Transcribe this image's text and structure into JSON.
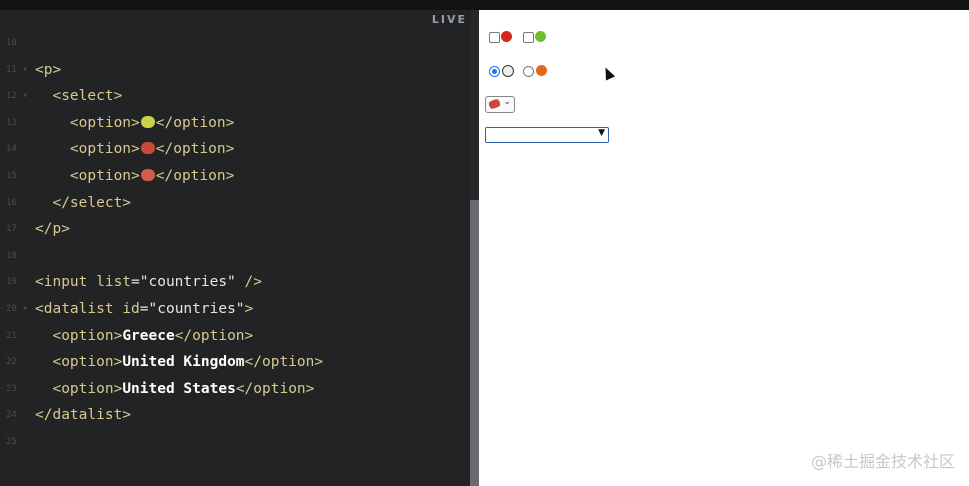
{
  "editor": {
    "live_label": "LIVE",
    "lines": [
      {
        "num": "10",
        "fold": "",
        "parts": []
      },
      {
        "num": "11",
        "fold": "▾",
        "parts": [
          {
            "c": "tag",
            "t": "<p>"
          }
        ]
      },
      {
        "num": "12",
        "fold": "▾",
        "parts": [
          {
            "c": "tag",
            "t": "  <select>"
          }
        ]
      },
      {
        "num": "13",
        "fold": "",
        "parts": [
          {
            "c": "tag",
            "t": "    <option>"
          },
          {
            "c": "emoji",
            "t": "avocado-emoji"
          },
          {
            "c": "tag",
            "t": "</option>"
          }
        ]
      },
      {
        "num": "14",
        "fold": "",
        "parts": [
          {
            "c": "tag",
            "t": "    <option>"
          },
          {
            "c": "emoji",
            "t": "steak-emoji"
          },
          {
            "c": "tag",
            "t": "</option>"
          }
        ]
      },
      {
        "num": "15",
        "fold": "",
        "parts": [
          {
            "c": "tag",
            "t": "    <option>"
          },
          {
            "c": "emoji",
            "t": "bacon-emoji"
          },
          {
            "c": "tag",
            "t": "</option>"
          }
        ]
      },
      {
        "num": "16",
        "fold": "",
        "parts": [
          {
            "c": "tag",
            "t": "  </select>"
          }
        ]
      },
      {
        "num": "17",
        "fold": "",
        "parts": [
          {
            "c": "tag",
            "t": "</p>"
          }
        ]
      },
      {
        "num": "18",
        "fold": "",
        "parts": []
      },
      {
        "num": "19",
        "fold": "",
        "parts": [
          {
            "c": "tag",
            "t": "<input "
          },
          {
            "c": "attr",
            "t": "list"
          },
          {
            "c": "str",
            "t": "=\"countries\""
          },
          {
            "c": "tag",
            "t": " />"
          }
        ]
      },
      {
        "num": "20",
        "fold": "▾",
        "parts": [
          {
            "c": "tag",
            "t": "<datalist "
          },
          {
            "c": "attr",
            "t": "id"
          },
          {
            "c": "str",
            "t": "=\"countries\""
          },
          {
            "c": "tag",
            "t": ">"
          }
        ]
      },
      {
        "num": "21",
        "fold": "",
        "parts": [
          {
            "c": "tag",
            "t": "  <option>"
          },
          {
            "c": "txt",
            "t": "Greece"
          },
          {
            "c": "tag",
            "t": "</option>"
          }
        ]
      },
      {
        "num": "22",
        "fold": "",
        "parts": [
          {
            "c": "tag",
            "t": "  <option>"
          },
          {
            "c": "txt",
            "t": "United Kingdom"
          },
          {
            "c": "tag",
            "t": "</option>"
          }
        ]
      },
      {
        "num": "23",
        "fold": "",
        "parts": [
          {
            "c": "tag",
            "t": "  <option>"
          },
          {
            "c": "txt",
            "t": "United States"
          },
          {
            "c": "tag",
            "t": "</option>"
          }
        ]
      },
      {
        "num": "24",
        "fold": "",
        "parts": [
          {
            "c": "tag",
            "t": "</datalist>"
          }
        ]
      },
      {
        "num": "25",
        "fold": "",
        "parts": []
      }
    ]
  },
  "preview": {
    "checkboxes": [
      {
        "icon": "red-apple-icon",
        "color": "#d7261e",
        "checked": false
      },
      {
        "icon": "green-apple-icon",
        "color": "#6cbf2a",
        "checked": false
      }
    ],
    "radios": [
      {
        "icon": "soccer-ball-icon",
        "color": "#9a9a9a",
        "checked": true
      },
      {
        "icon": "basketball-icon",
        "color": "#e06a1c",
        "checked": false
      }
    ],
    "select": {
      "selected_icon": "steak-emoji"
    },
    "datalist_input": {
      "value": ""
    }
  },
  "watermark": "@稀土掘金技术社区"
}
